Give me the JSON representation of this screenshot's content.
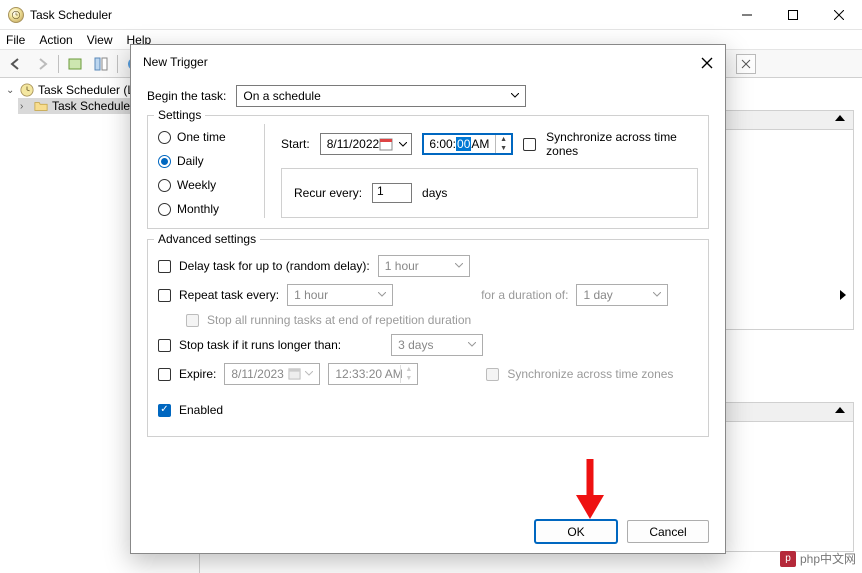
{
  "app": {
    "title": "Task Scheduler"
  },
  "menu": {
    "file": "File",
    "action": "Action",
    "view": "View",
    "help": "Help"
  },
  "tree": {
    "root": "Task Scheduler (L",
    "child": "Task Schedule"
  },
  "modal": {
    "title": "New Trigger",
    "begin_label": "Begin the task:",
    "begin_value": "On a schedule",
    "settings_legend": "Settings",
    "radios": {
      "one_time": "One time",
      "daily": "Daily",
      "weekly": "Weekly",
      "monthly": "Monthly"
    },
    "start_label": "Start:",
    "start_date": "8/11/2022",
    "start_time_pre": "6:00:",
    "start_time_sel": "00",
    "start_time_post": " AM",
    "sync_tz": "Synchronize across time zones",
    "recur_label": "Recur every:",
    "recur_value": "1",
    "recur_unit": "days",
    "adv_legend": "Advanced settings",
    "delay_label": "Delay task for up to (random delay):",
    "delay_value": "1 hour",
    "repeat_label": "Repeat task every:",
    "repeat_value": "1 hour",
    "duration_label": "for a duration of:",
    "duration_value": "1 day",
    "stop_all": "Stop all running tasks at end of repetition duration",
    "stop_if_label": "Stop task if it runs longer than:",
    "stop_if_value": "3 days",
    "expire_label": "Expire:",
    "expire_date": "8/11/2023",
    "expire_time": "12:33:20 AM",
    "sync_tz2": "Synchronize across time zones",
    "enabled_label": "Enabled",
    "ok": "OK",
    "cancel": "Cancel"
  },
  "watermark": "php中文网"
}
